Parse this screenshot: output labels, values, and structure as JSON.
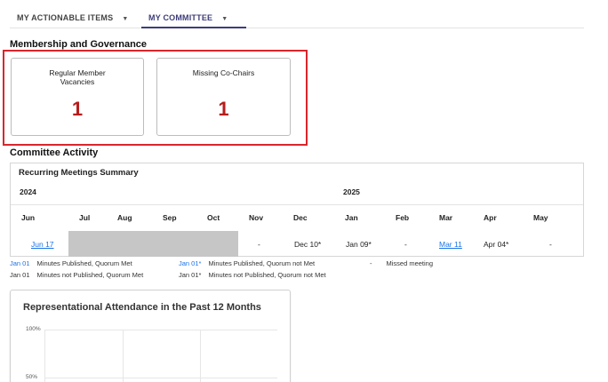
{
  "tabs": [
    {
      "label": "MY ACTIONABLE ITEMS"
    },
    {
      "label": "MY COMMITTEE"
    }
  ],
  "membership": {
    "title": "Membership and Governance",
    "cards": [
      {
        "label": "Regular Member Vacancies",
        "value": "1"
      },
      {
        "label": "Missing Co-Chairs",
        "value": "1"
      }
    ]
  },
  "activity": {
    "title": "Committee Activity",
    "meetings": {
      "title": "Recurring Meetings Summary",
      "years": [
        "2024",
        "2025"
      ],
      "months": [
        "Jun",
        "Jul",
        "Aug",
        "Sep",
        "Oct",
        "Nov",
        "Dec",
        "Jan",
        "Feb",
        "Mar",
        "Apr",
        "May"
      ],
      "cells": [
        "Jun 17",
        "",
        "",
        "",
        "",
        "-",
        "Dec 10*",
        "Jan 09*",
        "-",
        "Mar 11",
        "Apr 04*",
        "-"
      ]
    },
    "legend": [
      {
        "key": "Jan 01",
        "text": "Minutes Published, Quorum Met"
      },
      {
        "key": "Jan 01*",
        "text": "Minutes Published, Quorum not Met"
      },
      {
        "key": "-",
        "text": "Missed meeting"
      },
      {
        "key": "Jan 01",
        "text": "Minutes not Published, Quorum Met"
      },
      {
        "key": "Jan 01*",
        "text": "Minutes not Published, Quorum not Met"
      }
    ]
  },
  "attendance": {
    "title": "Representational Attendance in the Past 12 Months",
    "yticks": [
      "100%",
      "50%"
    ]
  }
}
